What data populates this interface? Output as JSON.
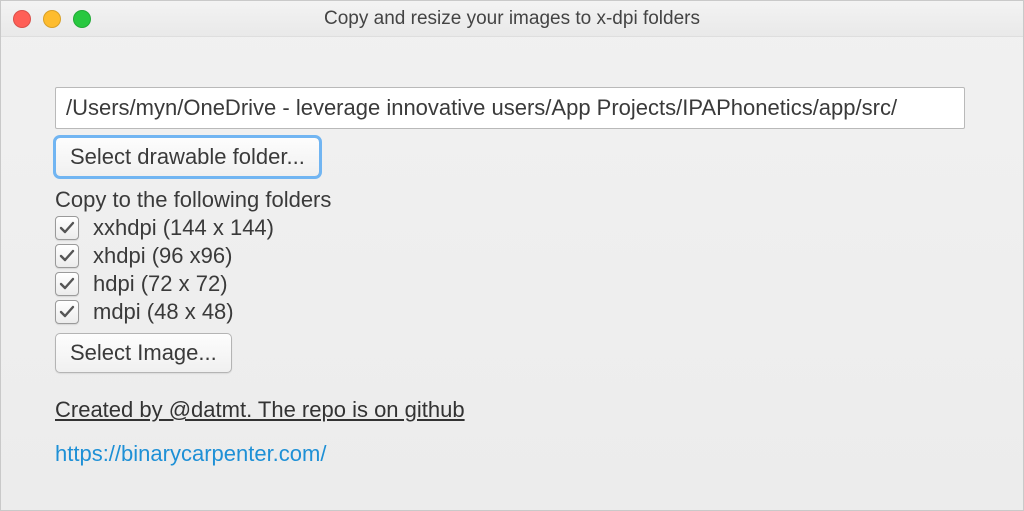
{
  "window": {
    "title": "Copy and resize your images to x-dpi folders"
  },
  "path_field": {
    "value": "/Users/myn/OneDrive - leverage innovative users/App Projects/IPAPhonetics/app/src/"
  },
  "buttons": {
    "select_folder": "Select drawable folder...",
    "select_image": "Select Image..."
  },
  "copy_label": "Copy to the following folders",
  "folders": [
    {
      "checked": true,
      "label": "xxhdpi (144 x 144)"
    },
    {
      "checked": true,
      "label": "xhdpi (96 x96)"
    },
    {
      "checked": true,
      "label": "hdpi (72 x 72)"
    },
    {
      "checked": true,
      "label": "mdpi (48 x 48)"
    }
  ],
  "credit": "Created by @datmt. The repo is on github",
  "url": "https://binarycarpenter.com/"
}
